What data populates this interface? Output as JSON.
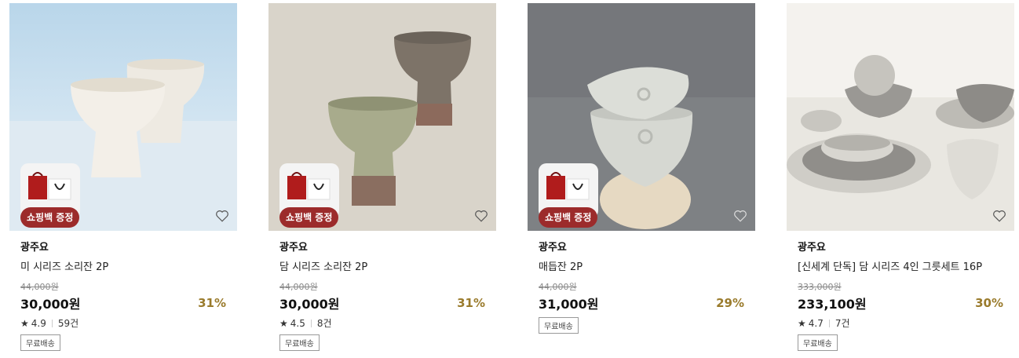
{
  "products": [
    {
      "brand": "광주요",
      "name": "미 시리즈 소리잔 2P",
      "original_price": "44,000원",
      "price": "30,000원",
      "discount": "31%",
      "rating": "4.9",
      "reviews": "59건",
      "gift_badge": "쇼핑백 증정",
      "shipping": "무료배송",
      "image_icon": "white-cups-image"
    },
    {
      "brand": "광주요",
      "name": "담 시리즈 소리잔 2P",
      "original_price": "44,000원",
      "price": "30,000원",
      "discount": "31%",
      "rating": "4.5",
      "reviews": "8건",
      "gift_badge": "쇼핑백 증정",
      "shipping": "무료배송",
      "image_icon": "green-cups-image"
    },
    {
      "brand": "광주요",
      "name": "매듭잔 2P",
      "original_price": "44,000원",
      "price": "31,000원",
      "discount": "29%",
      "gift_badge": "쇼핑백 증정",
      "shipping": "무료배송",
      "image_icon": "stacked-bowls-image"
    },
    {
      "brand": "광주요",
      "name": "[신세계 단독] 담 시리즈 4인 그릇세트 16P",
      "original_price": "333,000원",
      "price": "233,100원",
      "discount": "30%",
      "rating": "4.7",
      "reviews": "7건",
      "shipping": "무료배송",
      "image_icon": "dish-set-image"
    }
  ],
  "colors": {
    "discount": "#9a7b2c",
    "gift_badge": "#9c2b2b"
  }
}
